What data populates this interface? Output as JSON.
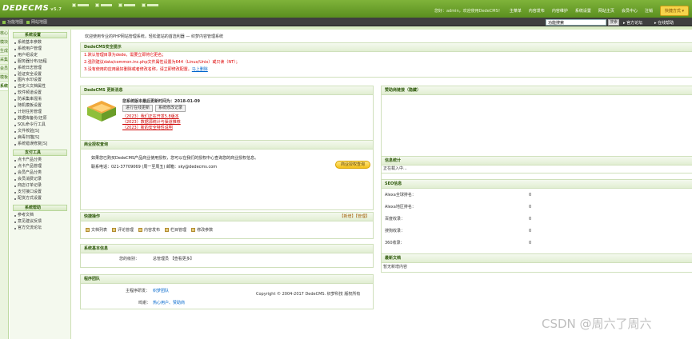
{
  "header": {
    "logo": "DEDECMS",
    "version": "v5.7",
    "welcome": "您好：admin，欢迎使用DedeCMS！",
    "nav": [
      "主菜单",
      "内容发布",
      "内容维护",
      "系统设置",
      "网站主页",
      "会员中心",
      "注销"
    ],
    "quick_button": "快捷方式 ▾"
  },
  "subbar": {
    "home": "功能地图",
    "site": "网站地图"
  },
  "search": {
    "value": "功能搜索",
    "button": "搜索",
    "forum": "官方论坛",
    "login": "在线帮助"
  },
  "vtabs": [
    "核心",
    "模块",
    "生成",
    "采集",
    "会员",
    "模板",
    "系统"
  ],
  "sidebar": {
    "groups": [
      {
        "title": "系统设置",
        "items": [
          "系统基本参数",
          "系统用户管理",
          "用户组设定",
          "服务器分布/远程",
          "系统日志管理",
          "验证安全设置",
          "图片水印设置",
          "自定义文档属性",
          "软件频道设置",
          "防采集串混淆",
          "随机模板设置",
          "计划任务管理",
          "数据库备份/还原",
          "SQL命令行工具",
          "文件校验[S]",
          "病毒扫描[S]",
          "系统错误修复[S]"
        ]
      },
      {
        "title": "支付工具",
        "items": [
          "点卡产品分类",
          "点卡产品管理",
          "会员产品分类",
          "会员消费记录",
          "商店订单记录",
          "支付接口设置",
          "配货方式设置"
        ]
      },
      {
        "title": "系统帮助",
        "items": [
          "参考文档",
          "意见建议反馈",
          "官方交流论坛"
        ]
      }
    ]
  },
  "main": {
    "welcome_line": "欢迎使用专业的PHP网站管理系统，轻松建站的首选利器 — 织梦内容管理系统",
    "security": {
      "title": "DedeCMS安全提示",
      "lines": [
        "1.默认管理目录为dede，需要立即将它更名；",
        "2.强烈建议data/common.inc.php文件属性设置为644（Linux/Unix）或只读（NT）；",
        "3.没有使用的应用最好删除或者修改名称，",
        "请立即修改配置。"
      ],
      "link": "马上删除"
    },
    "update": {
      "title": "DedeCMS 更新消息",
      "heading": "您系统版本最后更新时间为：2018-01-09",
      "buttons": [
        "进行在线更新",
        "系统修改记录"
      ],
      "news": [
        "（2023）我们正在开发5.8版本",
        "（2023）数据源统计与渠道推荐",
        "（2023）新的安全特性说明"
      ]
    },
    "business": {
      "title": "商业授权查询",
      "line1": "如果您已购买DedeCMS产品商业使用授权，您可以在我们的授权中心查询您的商业授权信息。",
      "line2": "联系电话：021-37709069 (周一至周五) 邮箱：sky@dedecms.com",
      "button": "商业授权查询"
    },
    "quick": {
      "title": "快捷操作",
      "right": "【新增】【管理】",
      "items": [
        "文档列表",
        "评论管理",
        "内容发布",
        "栏目管理",
        "修改参数"
      ]
    },
    "sysinfo": {
      "title": "系统基本信息",
      "label": "您的级别：",
      "value": "总管理员 【查看更多】"
    },
    "team": {
      "title": "程序团队",
      "row1_label": "主程序研发：",
      "row1_value": "织梦团队",
      "row2_label": "鸣谢：",
      "row2_value": "热心用户、赞助商"
    },
    "sponsor": {
      "title": "赞助商链接（隐藏）"
    },
    "info": {
      "title": "信息统计",
      "loading": "正在载入中..."
    },
    "stats": {
      "title": "SEO信息",
      "rows": [
        {
          "label": "Alexa全球排名：",
          "value": "0"
        },
        {
          "label": "Alexa地区排名：",
          "value": "0"
        },
        {
          "label": "百度收录：",
          "value": "0"
        },
        {
          "label": "搜狗收录：",
          "value": "0"
        },
        {
          "label": "360收录：",
          "value": "0"
        }
      ]
    },
    "latest": {
      "title": "最新文档",
      "value": "暂无新增内容"
    },
    "footer": "Copyright © 2004-2017 DedeCMS. 织梦科技 版权所有"
  },
  "watermark": "CSDN @周六了周六"
}
